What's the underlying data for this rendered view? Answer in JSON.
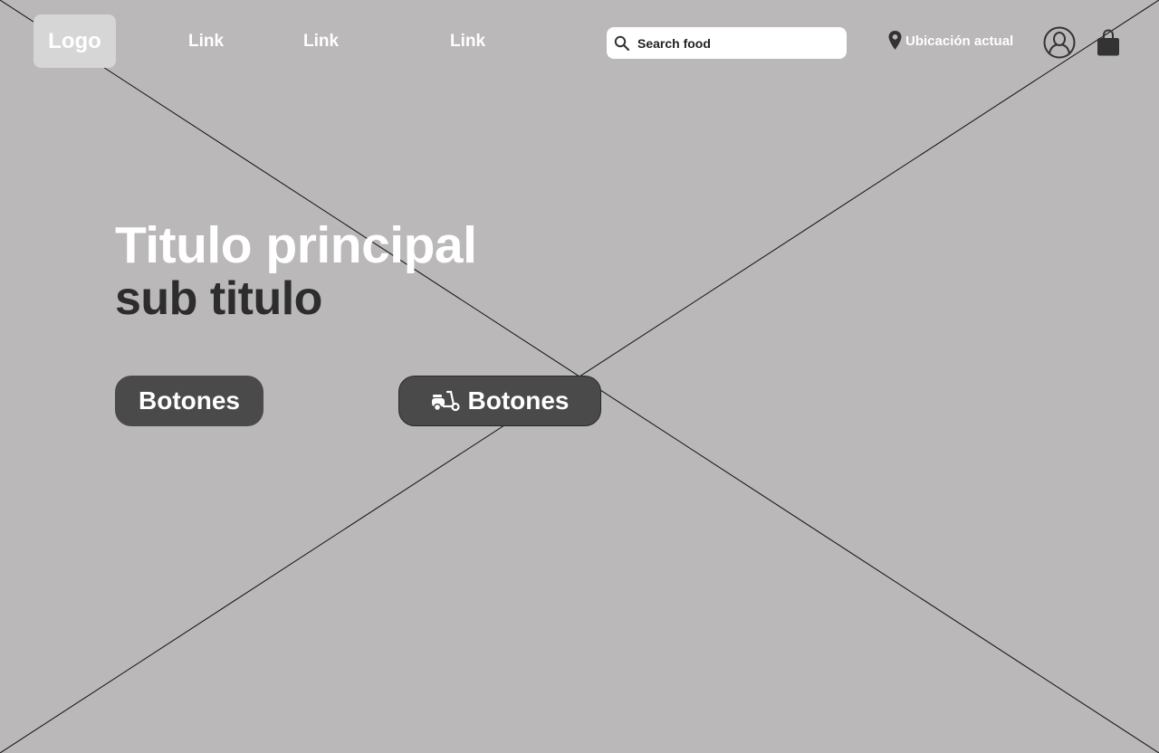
{
  "header": {
    "logo_label": "Logo",
    "nav_links": [
      "Link",
      "Link",
      "Link"
    ],
    "search": {
      "placeholder": "Search food",
      "icon": "search-icon"
    },
    "location": {
      "label": "Ubicación actual",
      "icon": "location-pin-icon"
    },
    "avatar_icon": "user-icon",
    "cart_icon": "shopping-bag-icon"
  },
  "hero": {
    "title": "Titulo principal",
    "subtitle": "sub titulo",
    "primary_button_label": "Botones",
    "delivery_button": {
      "label": "Botones",
      "icon": "scooter-icon"
    }
  },
  "colors": {
    "background": "#bab8b9",
    "button": "#4a4a4a",
    "logo_bg": "#d6d6d6",
    "subtitle": "#2d2d2d"
  }
}
